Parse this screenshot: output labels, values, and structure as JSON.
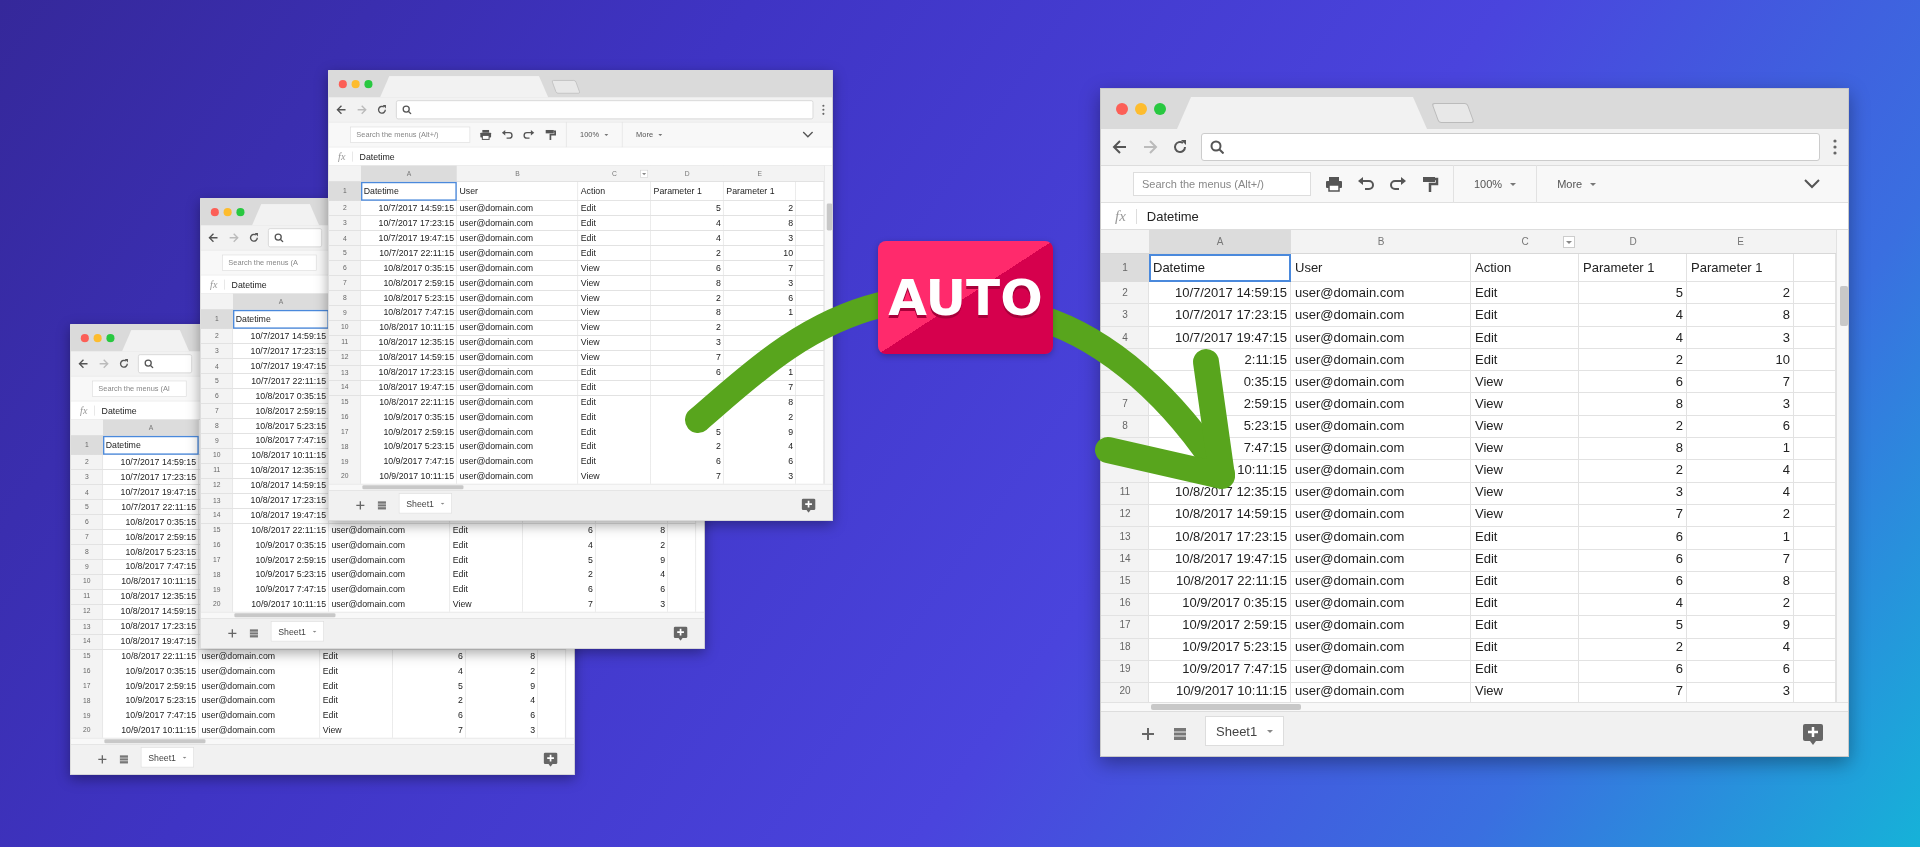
{
  "windows": [
    {
      "search_placeholder": "Search the menus (Al",
      "formula_label": "fx",
      "formula": "Datetime",
      "columns": [
        {
          "label": "A",
          "selected": true,
          "filter": false
        }
      ],
      "sheet_tab": "Sheet1",
      "rows": [
        {
          "number": "1",
          "kind": "header",
          "selected": true,
          "datetime": "Datetime"
        },
        {
          "number": "2",
          "kind": "data",
          "selected": false,
          "datetime": "10/7/2017 14:59:15"
        },
        {
          "number": "3",
          "kind": "data",
          "selected": false,
          "datetime": "10/7/2017 17:23:15"
        },
        {
          "number": "4",
          "kind": "data",
          "selected": false,
          "datetime": "10/7/2017 19:47:15"
        },
        {
          "number": "5",
          "kind": "data",
          "selected": false,
          "datetime": "10/7/2017 22:11:15"
        },
        {
          "number": "6",
          "kind": "data",
          "selected": false,
          "datetime": "10/8/2017 0:35:15"
        },
        {
          "number": "7",
          "kind": "data",
          "selected": false,
          "datetime": "10/8/2017 2:59:15"
        },
        {
          "number": "8",
          "kind": "data",
          "selected": false,
          "datetime": "10/8/2017 5:23:15"
        },
        {
          "number": "9",
          "kind": "data",
          "selected": false,
          "datetime": "10/8/2017 7:47:15"
        },
        {
          "number": "10",
          "kind": "data",
          "selected": false,
          "datetime": "10/8/2017 10:11:15"
        },
        {
          "number": "11",
          "kind": "data",
          "selected": false,
          "datetime": "10/8/2017 12:35:15"
        },
        {
          "number": "12",
          "kind": "data",
          "selected": false,
          "datetime": "10/8/2017 14:59:15"
        },
        {
          "number": "13",
          "kind": "data",
          "selected": false,
          "datetime": "10/8/2017 17:23:15"
        },
        {
          "number": "14",
          "kind": "data",
          "selected": false,
          "datetime": "10/8/2017 19:47:15"
        },
        {
          "number": "15",
          "kind": "data",
          "selected": false,
          "datetime": "10/8/2017 22:11:15",
          "user": "user@domain.com",
          "action": "Edit",
          "param_1": "6",
          "param_2": "8"
        },
        {
          "number": "16",
          "kind": "data",
          "selected": false,
          "datetime": "10/9/2017 0:35:15",
          "user": "user@domain.com",
          "action": "Edit",
          "param_1": "4",
          "param_2": "2"
        },
        {
          "number": "17",
          "kind": "data",
          "selected": false,
          "datetime": "10/9/2017 2:59:15",
          "user": "user@domain.com",
          "action": "Edit",
          "param_1": "5",
          "param_2": "9"
        },
        {
          "number": "18",
          "kind": "data",
          "selected": false,
          "datetime": "10/9/2017 5:23:15",
          "user": "user@domain.com",
          "action": "Edit",
          "param_1": "2",
          "param_2": "4"
        },
        {
          "number": "19",
          "kind": "data",
          "selected": false,
          "datetime": "10/9/2017 7:47:15",
          "user": "user@domain.com",
          "action": "Edit",
          "param_1": "6",
          "param_2": "6"
        },
        {
          "number": "20",
          "kind": "data",
          "selected": false,
          "datetime": "10/9/2017 10:11:15",
          "user": "user@domain.com",
          "action": "View",
          "param_1": "7",
          "param_2": "3"
        }
      ]
    },
    {
      "search_placeholder": "Search the menus (A",
      "formula_label": "fx",
      "formula": "Datetime",
      "columns": [
        {
          "label": "A",
          "selected": true,
          "filter": false
        }
      ],
      "sheet_tab": "Sheet1",
      "rows": [
        {
          "number": "1",
          "kind": "header",
          "selected": true,
          "datetime": "Datetime"
        },
        {
          "number": "2",
          "kind": "data",
          "selected": false,
          "datetime": "10/7/2017 14:59:15"
        },
        {
          "number": "3",
          "kind": "data",
          "selected": false,
          "datetime": "10/7/2017 17:23:15"
        },
        {
          "number": "4",
          "kind": "data",
          "selected": false,
          "datetime": "10/7/2017 19:47:15"
        },
        {
          "number": "5",
          "kind": "data",
          "selected": false,
          "datetime": "10/7/2017 22:11:15"
        },
        {
          "number": "6",
          "kind": "data",
          "selected": false,
          "datetime": "10/8/2017 0:35:15"
        },
        {
          "number": "7",
          "kind": "data",
          "selected": false,
          "datetime": "10/8/2017 2:59:15"
        },
        {
          "number": "8",
          "kind": "data",
          "selected": false,
          "datetime": "10/8/2017 5:23:15"
        },
        {
          "number": "9",
          "kind": "data",
          "selected": false,
          "datetime": "10/8/2017 7:47:15"
        },
        {
          "number": "10",
          "kind": "data",
          "selected": false,
          "datetime": "10/8/2017 10:11:15"
        },
        {
          "number": "11",
          "kind": "data",
          "selected": false,
          "datetime": "10/8/2017 12:35:15"
        },
        {
          "number": "12",
          "kind": "data",
          "selected": false,
          "datetime": "10/8/2017 14:59:15"
        },
        {
          "number": "13",
          "kind": "data",
          "selected": false,
          "datetime": "10/8/2017 17:23:15"
        },
        {
          "number": "14",
          "kind": "data",
          "selected": false,
          "datetime": "10/8/2017 19:47:15"
        },
        {
          "number": "15",
          "kind": "data",
          "selected": false,
          "datetime": "10/8/2017 22:11:15",
          "user": "user@domain.com",
          "action": "Edit",
          "param_1": "6",
          "param_2": "8"
        },
        {
          "number": "16",
          "kind": "data",
          "selected": false,
          "datetime": "10/9/2017 0:35:15",
          "user": "user@domain.com",
          "action": "Edit",
          "param_1": "4",
          "param_2": "2"
        },
        {
          "number": "17",
          "kind": "data",
          "selected": false,
          "datetime": "10/9/2017 2:59:15",
          "user": "user@domain.com",
          "action": "Edit",
          "param_1": "5",
          "param_2": "9"
        },
        {
          "number": "18",
          "kind": "data",
          "selected": false,
          "datetime": "10/9/2017 5:23:15",
          "user": "user@domain.com",
          "action": "Edit",
          "param_1": "2",
          "param_2": "4"
        },
        {
          "number": "19",
          "kind": "data",
          "selected": false,
          "datetime": "10/9/2017 7:47:15",
          "user": "user@domain.com",
          "action": "Edit",
          "param_1": "6",
          "param_2": "6"
        },
        {
          "number": "20",
          "kind": "data",
          "selected": false,
          "datetime": "10/9/2017 10:11:15",
          "user": "user@domain.com",
          "action": "View",
          "param_1": "7",
          "param_2": "3"
        }
      ]
    },
    {
      "search_placeholder": "Search the menus (Alt+/)",
      "zoom": "100%",
      "more": "More",
      "formula_label": "fx",
      "formula": "Datetime",
      "columns": [
        {
          "label": "A",
          "selected": true,
          "filter": false
        },
        {
          "label": "B",
          "selected": false,
          "filter": false
        },
        {
          "label": "C",
          "selected": false,
          "filter": true
        },
        {
          "label": "D",
          "selected": false,
          "filter": false
        },
        {
          "label": "E",
          "selected": false,
          "filter": false
        }
      ],
      "sheet_tab": "Sheet1",
      "rows": [
        {
          "number": "1",
          "kind": "header",
          "selected": true,
          "datetime": "Datetime",
          "user": "User",
          "action": "Action",
          "param_1": "Parameter 1",
          "param_2": "Parameter 1"
        },
        {
          "number": "2",
          "kind": "data",
          "selected": false,
          "datetime": "10/7/2017 14:59:15",
          "user": "user@domain.com",
          "action": "Edit",
          "param_1": "5",
          "param_2": "2"
        },
        {
          "number": "3",
          "kind": "data",
          "selected": false,
          "datetime": "10/7/2017 17:23:15",
          "user": "user@domain.com",
          "action": "Edit",
          "param_1": "4",
          "param_2": "8"
        },
        {
          "number": "4",
          "kind": "data",
          "selected": false,
          "datetime": "10/7/2017 19:47:15",
          "user": "user@domain.com",
          "action": "Edit",
          "param_1": "4",
          "param_2": "3"
        },
        {
          "number": "5",
          "kind": "data",
          "selected": false,
          "datetime": "10/7/2017 22:11:15",
          "user": "user@domain.com",
          "action": "Edit",
          "param_1": "2",
          "param_2": "10"
        },
        {
          "number": "6",
          "kind": "data",
          "selected": false,
          "datetime": "10/8/2017 0:35:15",
          "user": "user@domain.com",
          "action": "View",
          "param_1": "6",
          "param_2": "7"
        },
        {
          "number": "7",
          "kind": "data",
          "selected": false,
          "datetime": "10/8/2017 2:59:15",
          "user": "user@domain.com",
          "action": "View",
          "param_1": "8",
          "param_2": "3"
        },
        {
          "number": "8",
          "kind": "data",
          "selected": false,
          "datetime": "10/8/2017 5:23:15",
          "user": "user@domain.com",
          "action": "View",
          "param_1": "2",
          "param_2": "6"
        },
        {
          "number": "9",
          "kind": "data",
          "selected": false,
          "datetime": "10/8/2017 7:47:15",
          "user": "user@domain.com",
          "action": "View",
          "param_1": "8",
          "param_2": "1"
        },
        {
          "number": "10",
          "kind": "data",
          "selected": false,
          "datetime": "10/8/2017 10:11:15",
          "user": "user@domain.com",
          "action": "View",
          "param_1": "2"
        },
        {
          "number": "11",
          "kind": "data",
          "selected": false,
          "datetime": "10/8/2017 12:35:15",
          "user": "user@domain.com",
          "action": "View",
          "param_1": "3"
        },
        {
          "number": "12",
          "kind": "data",
          "selected": false,
          "datetime": "10/8/2017 14:59:15",
          "user": "user@domain.com",
          "action": "View",
          "param_1": "7"
        },
        {
          "number": "13",
          "kind": "data",
          "selected": false,
          "datetime": "10/8/2017 17:23:15",
          "user": "user@domain.com",
          "action": "Edit",
          "param_1": "6",
          "param_2": "1"
        },
        {
          "number": "14",
          "kind": "data",
          "selected": false,
          "datetime": "10/8/2017 19:47:15",
          "user": "user@domain.com",
          "action": "Edit",
          "param_2": "7"
        },
        {
          "number": "15",
          "kind": "data",
          "selected": false,
          "datetime": "10/8/2017 22:11:15",
          "user": "user@domain.com",
          "action": "Edit",
          "param_2": "8"
        },
        {
          "number": "16",
          "kind": "data",
          "selected": false,
          "datetime": "10/9/2017 0:35:15",
          "user": "user@domain.com",
          "action": "Edit",
          "param_2": "2"
        },
        {
          "number": "17",
          "kind": "data",
          "selected": false,
          "datetime": "10/9/2017 2:59:15",
          "user": "user@domain.com",
          "action": "Edit",
          "param_1": "5",
          "param_2": "9"
        },
        {
          "number": "18",
          "kind": "data",
          "selected": false,
          "datetime": "10/9/2017 5:23:15",
          "user": "user@domain.com",
          "action": "Edit",
          "param_1": "2",
          "param_2": "4"
        },
        {
          "number": "19",
          "kind": "data",
          "selected": false,
          "datetime": "10/9/2017 7:47:15",
          "user": "user@domain.com",
          "action": "Edit",
          "param_1": "6",
          "param_2": "6"
        },
        {
          "number": "20",
          "kind": "data",
          "selected": false,
          "datetime": "10/9/2017 10:11:15",
          "user": "user@domain.com",
          "action": "View",
          "param_1": "7",
          "param_2": "3"
        }
      ]
    },
    {
      "search_placeholder": "Search the menus (Alt+/)",
      "zoom": "100%",
      "more": "More",
      "formula_label": "fx",
      "formula": "Datetime",
      "columns": [
        {
          "label": "A",
          "selected": true,
          "filter": false
        },
        {
          "label": "B",
          "selected": false,
          "filter": false
        },
        {
          "label": "C",
          "selected": false,
          "filter": true
        },
        {
          "label": "D",
          "selected": false,
          "filter": false
        },
        {
          "label": "E",
          "selected": false,
          "filter": false
        }
      ],
      "sheet_tab": "Sheet1",
      "rows": [
        {
          "number": "1",
          "kind": "header",
          "selected": true,
          "datetime": "Datetime",
          "user": "User",
          "action": "Action",
          "param_1": "Parameter 1",
          "param_2": "Parameter 1"
        },
        {
          "number": "2",
          "kind": "data",
          "selected": false,
          "datetime": "10/7/2017 14:59:15",
          "user": "user@domain.com",
          "action": "Edit",
          "param_1": "5",
          "param_2": "2"
        },
        {
          "number": "3",
          "kind": "data",
          "selected": false,
          "datetime": "10/7/2017 17:23:15",
          "user": "user@domain.com",
          "action": "Edit",
          "param_1": "4",
          "param_2": "8"
        },
        {
          "number": "4",
          "kind": "data",
          "selected": false,
          "datetime": "10/7/2017 19:47:15",
          "user": "user@domain.com",
          "action": "Edit",
          "param_1": "4",
          "param_2": "3"
        },
        {
          "kind": "data",
          "selected": false,
          "datetime": "2:11:15",
          "user": "user@domain.com",
          "action": "Edit",
          "param_1": "2",
          "param_2": "10"
        },
        {
          "kind": "data",
          "selected": false,
          "datetime": "0:35:15",
          "user": "user@domain.com",
          "action": "View",
          "param_1": "6",
          "param_2": "7"
        },
        {
          "number": "7",
          "kind": "data",
          "selected": false,
          "datetime": "2:59:15",
          "user": "user@domain.com",
          "action": "View",
          "param_1": "8",
          "param_2": "3"
        },
        {
          "number": "8",
          "kind": "data",
          "selected": false,
          "datetime": "5:23:15",
          "user": "user@domain.com",
          "action": "View",
          "param_1": "2",
          "param_2": "6"
        },
        {
          "kind": "data",
          "selected": false,
          "datetime": "7:47:15",
          "user": "user@domain.com",
          "action": "View",
          "param_1": "8",
          "param_2": "1"
        },
        {
          "kind": "data",
          "selected": false,
          "datetime": "10:11:15",
          "user": "user@domain.com",
          "action": "View",
          "param_1": "2",
          "param_2": "4"
        },
        {
          "number": "11",
          "kind": "data",
          "selected": false,
          "datetime": "10/8/2017 12:35:15",
          "user": "user@domain.com",
          "action": "View",
          "param_1": "3",
          "param_2": "4"
        },
        {
          "number": "12",
          "kind": "data",
          "selected": false,
          "datetime": "10/8/2017 14:59:15",
          "user": "user@domain.com",
          "action": "View",
          "param_1": "7",
          "param_2": "2"
        },
        {
          "number": "13",
          "kind": "data",
          "selected": false,
          "datetime": "10/8/2017 17:23:15",
          "user": "user@domain.com",
          "action": "Edit",
          "param_1": "6",
          "param_2": "1"
        },
        {
          "number": "14",
          "kind": "data",
          "selected": false,
          "datetime": "10/8/2017 19:47:15",
          "user": "user@domain.com",
          "action": "Edit",
          "param_1": "6",
          "param_2": "7"
        },
        {
          "number": "15",
          "kind": "data",
          "selected": false,
          "datetime": "10/8/2017 22:11:15",
          "user": "user@domain.com",
          "action": "Edit",
          "param_1": "6",
          "param_2": "8"
        },
        {
          "number": "16",
          "kind": "data",
          "selected": false,
          "datetime": "10/9/2017 0:35:15",
          "user": "user@domain.com",
          "action": "Edit",
          "param_1": "4",
          "param_2": "2"
        },
        {
          "number": "17",
          "kind": "data",
          "selected": false,
          "datetime": "10/9/2017 2:59:15",
          "user": "user@domain.com",
          "action": "Edit",
          "param_1": "5",
          "param_2": "9"
        },
        {
          "number": "18",
          "kind": "data",
          "selected": false,
          "datetime": "10/9/2017 5:23:15",
          "user": "user@domain.com",
          "action": "Edit",
          "param_1": "2",
          "param_2": "4"
        },
        {
          "number": "19",
          "kind": "data",
          "selected": false,
          "datetime": "10/9/2017 7:47:15",
          "user": "user@domain.com",
          "action": "Edit",
          "param_1": "6",
          "param_2": "6"
        },
        {
          "number": "20",
          "kind": "data",
          "selected": false,
          "datetime": "10/9/2017 10:11:15",
          "user": "user@domain.com",
          "action": "View",
          "param_1": "7",
          "param_2": "3"
        }
      ]
    }
  ],
  "badge": {
    "label": "AUTO"
  }
}
